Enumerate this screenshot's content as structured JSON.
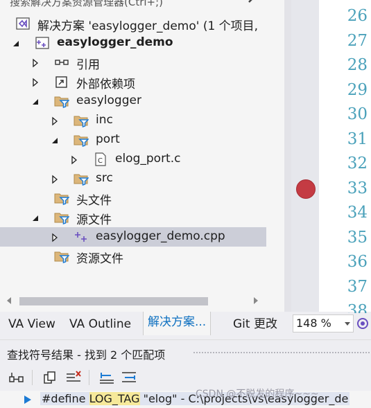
{
  "explorer": {
    "search_placeholder": "搜索解决方案资源管理器(Ctrl+;)",
    "tree": [
      {
        "label": "解决方案 'easylogger_demo' (1 个项目,",
        "icon": "solution-icon",
        "expander": "none",
        "bold": false
      },
      {
        "label": "easylogger_demo",
        "icon": "cpp-project-icon",
        "expander": "expanded",
        "bold": true
      },
      {
        "label": "引用",
        "icon": "references-icon",
        "expander": "collapsed",
        "bold": false
      },
      {
        "label": "外部依赖项",
        "icon": "external-deps-icon",
        "expander": "collapsed",
        "bold": false
      },
      {
        "label": "easylogger",
        "icon": "filter-folder-icon",
        "expander": "expanded",
        "bold": false
      },
      {
        "label": "inc",
        "icon": "filter-folder-icon",
        "expander": "collapsed",
        "bold": false
      },
      {
        "label": "port",
        "icon": "filter-folder-icon",
        "expander": "expanded",
        "bold": false
      },
      {
        "label": "elog_port.c",
        "icon": "c-file-icon",
        "expander": "collapsed",
        "bold": false
      },
      {
        "label": "src",
        "icon": "filter-folder-icon",
        "expander": "collapsed",
        "bold": false
      },
      {
        "label": "头文件",
        "icon": "filter-folder-icon",
        "expander": "none",
        "bold": false
      },
      {
        "label": "源文件",
        "icon": "filter-folder-icon",
        "expander": "expanded",
        "bold": false
      },
      {
        "label": "easylogger_demo.cpp",
        "icon": "cpp-file-icon",
        "expander": "collapsed",
        "bold": false,
        "selected": true
      },
      {
        "label": "资源文件",
        "icon": "filter-folder-icon",
        "expander": "none",
        "bold": false
      }
    ]
  },
  "tabs": [
    {
      "label": "VA View",
      "active": false
    },
    {
      "label": "VA Outline",
      "active": false
    },
    {
      "label": "解决方案...",
      "active": true
    },
    {
      "label": "Git 更改",
      "active": false
    }
  ],
  "editor": {
    "line_numbers": [
      "26",
      "27",
      "28",
      "29",
      "30",
      "31",
      "32",
      "33",
      "34",
      "35",
      "36",
      "37",
      "38"
    ],
    "breakpoint_line": "33",
    "zoom": "148 %"
  },
  "find_results": {
    "title": "查找符号结果 - 找到 2 个匹配项",
    "row": {
      "prefix": "#define ",
      "match": "LOG_TAG",
      "suffix": " \"elog\" - C:\\projects\\vs\\easylogger_de"
    }
  },
  "watermark": "CSDN @不脱发的程序~~~"
}
